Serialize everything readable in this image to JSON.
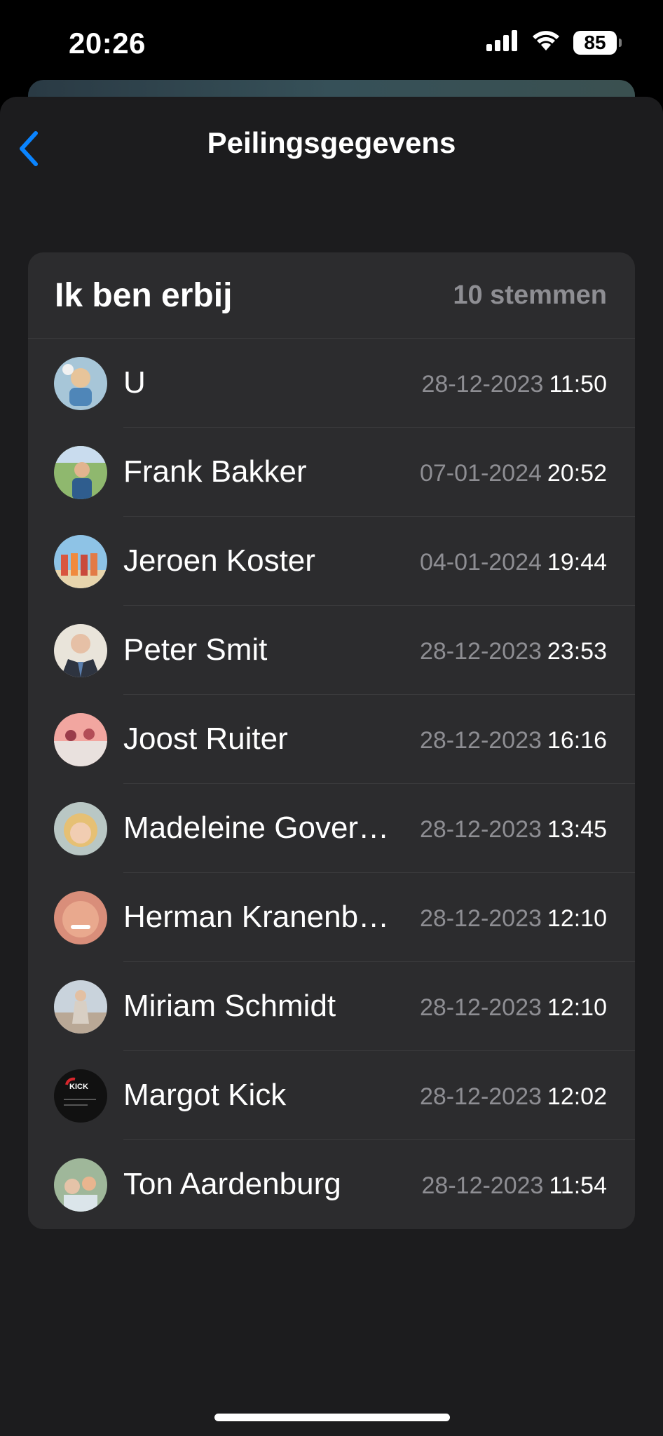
{
  "status_bar": {
    "time": "20:26",
    "battery": "85",
    "icons": [
      "cellular-signal-icon",
      "wifi-icon",
      "battery-icon"
    ]
  },
  "nav": {
    "title": "Peilingsgegevens",
    "back_icon": "chevron-left-icon",
    "accent": "#0a84ff"
  },
  "poll": {
    "option": "Ik ben erbij",
    "count": "10 stemmen"
  },
  "voters": [
    {
      "name": "U",
      "date": "28-12-2023",
      "time": "11:50"
    },
    {
      "name": "Frank Bakker",
      "date": "07-01-2024",
      "time": "20:52"
    },
    {
      "name": "Jeroen Koster",
      "date": "04-01-2024",
      "time": "19:44"
    },
    {
      "name": "Peter Smit",
      "date": "28-12-2023",
      "time": "23:53"
    },
    {
      "name": "Joost Ruiter",
      "date": "28-12-2023",
      "time": "16:16"
    },
    {
      "name": "Madeleine Gover…",
      "date": "28-12-2023",
      "time": "13:45"
    },
    {
      "name": "Herman Kranenb…",
      "date": "28-12-2023",
      "time": "12:10"
    },
    {
      "name": "Miriam Schmidt",
      "date": "28-12-2023",
      "time": "12:10"
    },
    {
      "name": "Margot Kick",
      "date": "28-12-2023",
      "time": "12:02"
    },
    {
      "name": "Ton Aardenburg",
      "date": "28-12-2023",
      "time": "11:54"
    }
  ],
  "avatar_logo_text": "KICK"
}
